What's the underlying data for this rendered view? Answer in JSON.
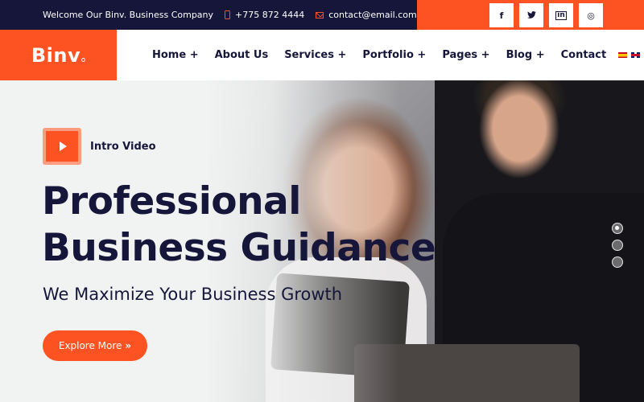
{
  "topbar": {
    "welcome": "Welcome Our Binv. Business Company",
    "phone_icon": "mobile-phone-icon",
    "phone": "+775 872 4444",
    "email_icon": "envelope-icon",
    "email": "contact@email.com",
    "socials": [
      {
        "name": "facebook-icon",
        "glyph": "f"
      },
      {
        "name": "twitter-icon",
        "glyph": "🐦"
      },
      {
        "name": "linkedin-icon",
        "glyph": "in"
      },
      {
        "name": "instagram-icon",
        "glyph": "◎"
      }
    ]
  },
  "brand": {
    "logo": "Binv",
    "accent_color": "#fd5221",
    "dark_color": "#16163a"
  },
  "nav": {
    "items": [
      {
        "label": "Home +"
      },
      {
        "label": "About Us"
      },
      {
        "label": "Services +"
      },
      {
        "label": "Portfolio +"
      },
      {
        "label": "Pages +"
      },
      {
        "label": "Blog +"
      },
      {
        "label": "Contact"
      }
    ],
    "languages": [
      "es-flag-icon",
      "uk-flag-icon"
    ],
    "search_icon": "search-icon"
  },
  "hero": {
    "intro_video_label": "Intro Video",
    "title_line1": "Professional",
    "title_line2": "Business Guidance",
    "subtitle": "We Maximize Your Business Growth",
    "cta_label": "Explore More",
    "cta_icon": "»",
    "slider": {
      "count": 3,
      "active_index": 0
    }
  }
}
